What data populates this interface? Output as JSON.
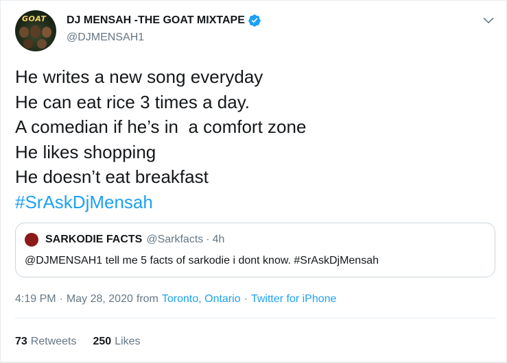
{
  "author": {
    "display_name": "DJ MENSAH -THE GOAT MIXTAPE",
    "handle": "@DJMENSAH1",
    "avatar_text": "GOAT",
    "verified": true
  },
  "tweet": {
    "lines": [
      "He writes a new song everyday",
      "He can eat rice 3 times a day.",
      "A comedian if he’s in  a comfort zone",
      "He likes shopping",
      "He doesn’t eat breakfast"
    ],
    "hashtag": "#SrAskDjMensah"
  },
  "quoted_tweet": {
    "display_name": "SARKODIE FACTS",
    "handle": "@Sarkfacts",
    "separator": "·",
    "time": "4h",
    "text": "@DJMENSAH1 tell me 5 facts of sarkodie i dont know. #SrAskDjMensah"
  },
  "meta": {
    "time": "4:19 PM",
    "date": "May 28, 2020",
    "from_label": "from",
    "location": "Toronto, Ontario",
    "source": "Twitter for iPhone",
    "separator": "·"
  },
  "stats": {
    "retweets_count": "73",
    "retweets_label": "Retweets",
    "likes_count": "250",
    "likes_label": "Likes"
  },
  "colors": {
    "accent": "#1da1f2",
    "text": "#14171a",
    "muted": "#657786",
    "border": "#ccd6dd"
  },
  "icons": {
    "verified": "verified-badge-icon",
    "menu": "chevron-down-icon"
  }
}
